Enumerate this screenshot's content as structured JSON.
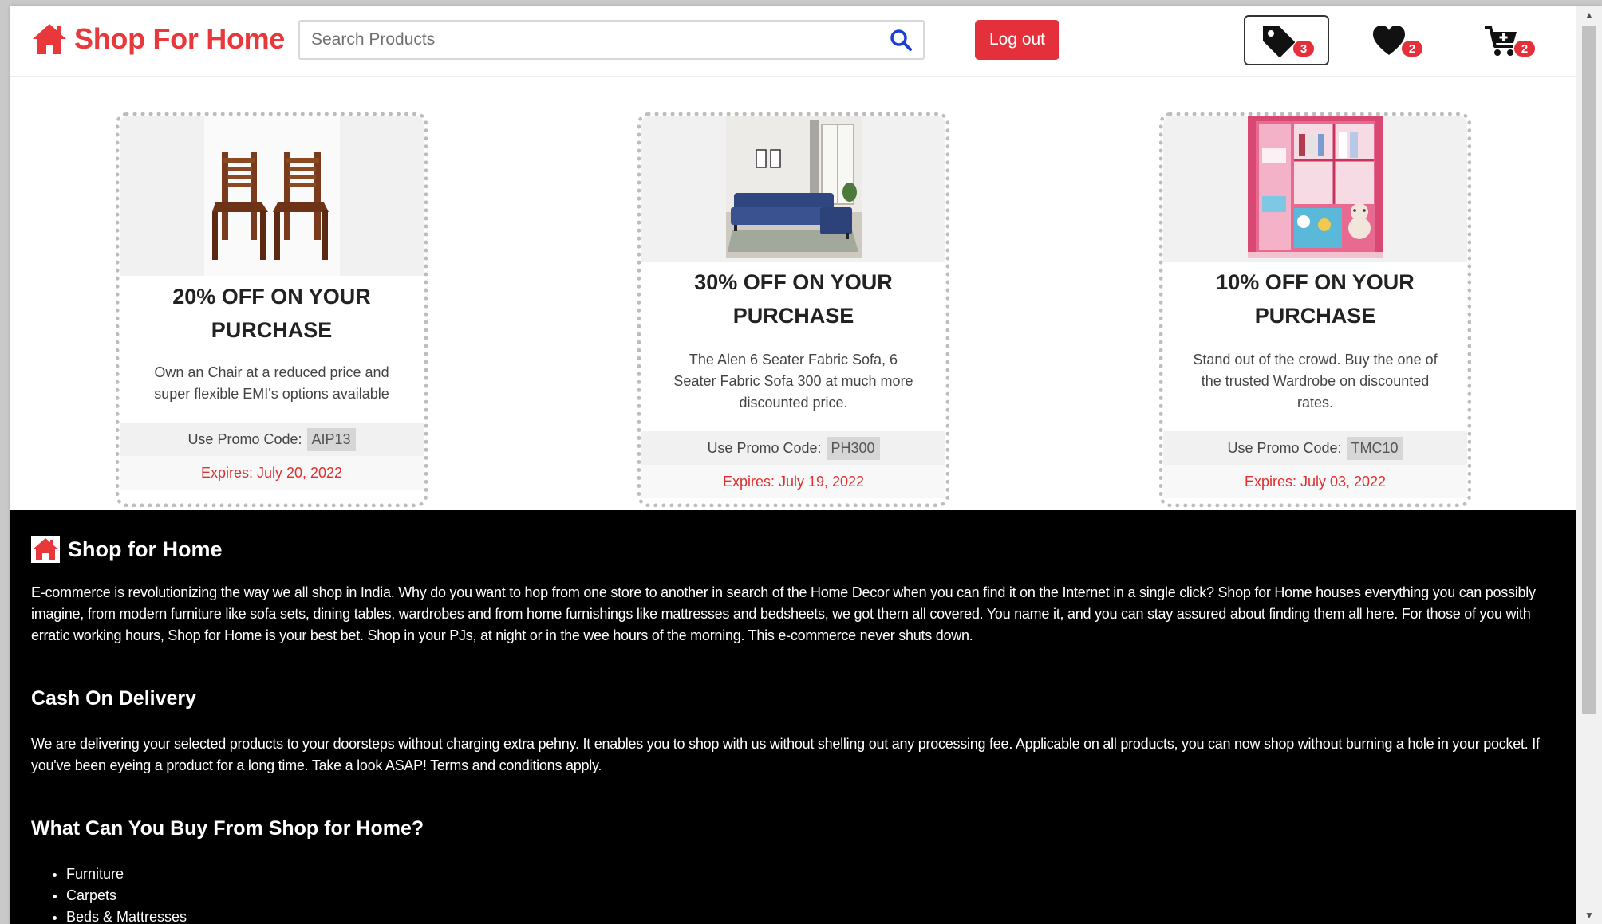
{
  "header": {
    "brand_name": "Shop For Home",
    "search_placeholder": "Search Products",
    "logout_label": "Log out",
    "offers_count": "3",
    "wishlist_count": "2",
    "cart_count": "2"
  },
  "offers": [
    {
      "title": "20% OFF ON YOUR PURCHASE",
      "description": "Own an Chair at a reduced price and super flexible EMI's options available",
      "promo_label": "Use Promo Code:",
      "promo_code": "AIP13",
      "expires": "Expires: July 20, 2022",
      "image": "wooden-chairs"
    },
    {
      "title": "30% OFF ON YOUR PURCHASE",
      "description": "The Alen 6 Seater Fabric Sofa, 6 Seater Fabric Sofa 300 at much more discounted price.",
      "promo_label": "Use Promo Code:",
      "promo_code": "PH300",
      "expires": "Expires: July 19, 2022",
      "image": "blue-sofa"
    },
    {
      "title": "10% OFF ON YOUR PURCHASE",
      "description": "Stand out of the crowd. Buy the one of the trusted Wardrobe on discounted rates.",
      "promo_label": "Use Promo Code:",
      "promo_code": "TMC10",
      "expires": "Expires: July 03, 2022",
      "image": "pink-wardrobe"
    }
  ],
  "info": {
    "brand_name": "Shop for Home",
    "intro": "E-commerce is revolutionizing the way we all shop in India. Why do you want to hop from one store to another in search of the Home Decor when you can find it on the Internet in a single click? Shop for Home houses everything you can possibly imagine, from modern furniture like sofa sets, dining tables, wardrobes and from home furnishings like mattresses and bedsheets, we got them all covered. You name it, and you can stay assured about finding them all here. For those of you with erratic working hours, Shop for Home is your best bet. Shop in your PJs, at night or in the wee hours of the morning. This e-commerce never shuts down.",
    "cod_heading": "Cash On Delivery",
    "cod_text": "We are delivering your selected products to your doorsteps without charging extra pehny. It enables you to shop with us without shelling out any processing fee. Applicable on all products, you can now shop without burning a hole in your pocket. If you've been eyeing a product for a long time. Take a look ASAP! Terms and conditions apply.",
    "buy_heading": "What Can You Buy From Shop for Home?",
    "categories": [
      "Furniture",
      "Carpets",
      "Beds & Mattresses"
    ]
  },
  "colors": {
    "brand_red": "#e8383b",
    "button_red": "#e4303b",
    "expiry_red": "#e02f2f",
    "search_blue": "#1a3fd6"
  },
  "icons": [
    "home-icon",
    "search-icon",
    "tag-icon",
    "heart-icon",
    "cart-plus-icon"
  ]
}
